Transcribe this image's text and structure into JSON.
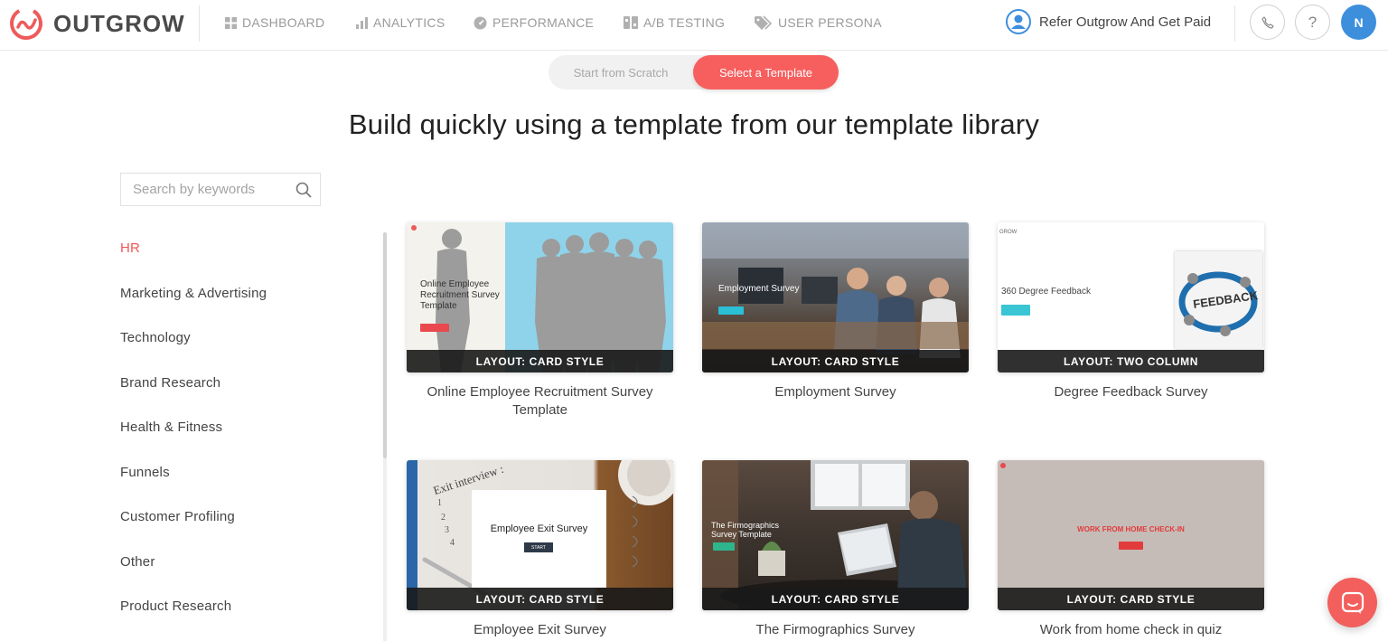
{
  "brand": {
    "name": "OUTGROW",
    "accent": "#f25757"
  },
  "nav": {
    "items": [
      {
        "label": "DASHBOARD",
        "icon": "grid-icon"
      },
      {
        "label": "ANALYTICS",
        "icon": "bar-chart-icon"
      },
      {
        "label": "PERFORMANCE",
        "icon": "gauge-icon"
      },
      {
        "label": "A/B TESTING",
        "icon": "ab-test-icon"
      },
      {
        "label": "USER PERSONA",
        "icon": "tag-icon"
      }
    ],
    "refer": "Refer Outgrow And Get Paid",
    "avatar_initial": "N"
  },
  "toggle": {
    "scratch": "Start from Scratch",
    "template": "Select a Template",
    "selected": "template"
  },
  "headline": "Build quickly using a template from our template library",
  "search": {
    "placeholder": "Search by keywords",
    "value": ""
  },
  "categories": [
    {
      "label": "HR",
      "active": true
    },
    {
      "label": "Marketing & Advertising",
      "active": false
    },
    {
      "label": "Technology",
      "active": false
    },
    {
      "label": "Brand Research",
      "active": false
    },
    {
      "label": "Health & Fitness",
      "active": false
    },
    {
      "label": "Funnels",
      "active": false
    },
    {
      "label": "Customer Profiling",
      "active": false
    },
    {
      "label": "Other",
      "active": false
    },
    {
      "label": "Product Research",
      "active": false
    }
  ],
  "templates": [
    {
      "title": "Online Employee Recruitment Survey Template",
      "layout": "LAYOUT: CARD STYLE",
      "thumb_heading": "Online Employee Recruitment Survey Template"
    },
    {
      "title": "Employment Survey",
      "layout": "LAYOUT: CARD STYLE",
      "thumb_heading": "Employment Survey"
    },
    {
      "title": "Degree Feedback Survey",
      "layout": "LAYOUT: TWO COLUMN",
      "thumb_heading": "360 Degree Feedback",
      "thumb_logo": "GROW",
      "thumb_image_text": "FEEDBACK"
    },
    {
      "title": "Employee Exit Survey",
      "layout": "LAYOUT: CARD STYLE",
      "thumb_heading": "Employee Exit Survey",
      "thumb_button": "START",
      "thumb_note": "Exit interview :"
    },
    {
      "title": "The Firmographics Survey",
      "layout": "LAYOUT: CARD STYLE",
      "thumb_heading": "The Firmographics Survey Template"
    },
    {
      "title": "Work from home check in quiz",
      "layout": "LAYOUT: CARD STYLE",
      "thumb_heading": "WORK FROM HOME CHECK-IN"
    }
  ]
}
